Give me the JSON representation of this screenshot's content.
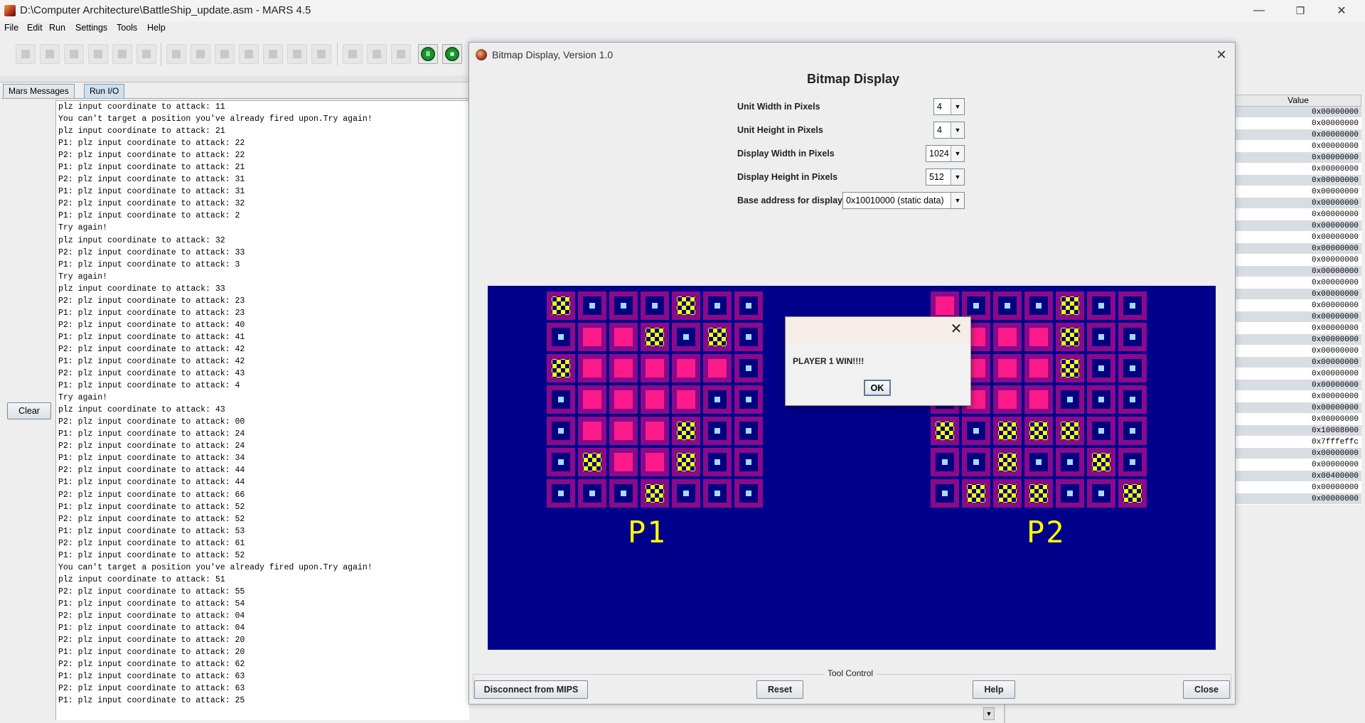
{
  "window": {
    "title": "D:\\Computer Architecture\\BattleShip_update.asm  - MARS 4.5",
    "minimize": "—",
    "maximize": "❐",
    "close": "✕"
  },
  "menu": [
    "File",
    "Edit",
    "Run",
    "Settings",
    "Tools",
    "Help"
  ],
  "tabs": [
    "Mars Messages",
    "Run I/O"
  ],
  "clear_label": "Clear",
  "console_lines": [
    "plz input coordinate to attack: 11",
    "You can't target a position you've already fired upon.Try again!",
    "plz input coordinate to attack: 21",
    "P1: plz input coordinate to attack: 22",
    "P2: plz input coordinate to attack: 22",
    "P1: plz input coordinate to attack: 21",
    "P2: plz input coordinate to attack: 31",
    "P1: plz input coordinate to attack: 31",
    "P2: plz input coordinate to attack: 32",
    "P1: plz input coordinate to attack: 2",
    "Try again!",
    "plz input coordinate to attack: 32",
    "P2: plz input coordinate to attack: 33",
    "P1: plz input coordinate to attack: 3",
    "Try again!",
    "plz input coordinate to attack: 33",
    "P2: plz input coordinate to attack: 23",
    "P1: plz input coordinate to attack: 23",
    "P2: plz input coordinate to attack: 40",
    "P1: plz input coordinate to attack: 41",
    "P2: plz input coordinate to attack: 42",
    "P1: plz input coordinate to attack: 42",
    "P2: plz input coordinate to attack: 43",
    "P1: plz input coordinate to attack: 4",
    "Try again!",
    "plz input coordinate to attack: 43",
    "P2: plz input coordinate to attack: 00",
    "P1: plz input coordinate to attack: 24",
    "P2: plz input coordinate to attack: 24",
    "P1: plz input coordinate to attack: 34",
    "P2: plz input coordinate to attack: 44",
    "P1: plz input coordinate to attack: 44",
    "P2: plz input coordinate to attack: 66",
    "P1: plz input coordinate to attack: 52",
    "P2: plz input coordinate to attack: 52",
    "P1: plz input coordinate to attack: 53",
    "P2: plz input coordinate to attack: 61",
    "P1: plz input coordinate to attack: 52",
    "You can't target a position you've already fired upon.Try again!",
    "plz input coordinate to attack: 51",
    "P2: plz input coordinate to attack: 55",
    "P1: plz input coordinate to attack: 54",
    "P2: plz input coordinate to attack: 04",
    "P1: plz input coordinate to attack: 04",
    "P2: plz input coordinate to attack: 20",
    "P1: plz input coordinate to attack: 20",
    "P2: plz input coordinate to attack: 62",
    "P1: plz input coordinate to attack: 63",
    "P2: plz input coordinate to attack: 63",
    "P1: plz input coordinate to attack: 25"
  ],
  "registers": {
    "header": "Value",
    "values": [
      "0x00000000",
      "0x00000000",
      "0x00000000",
      "0x00000000",
      "0x00000000",
      "0x00000000",
      "0x00000000",
      "0x00000000",
      "0x00000000",
      "0x00000000",
      "0x00000000",
      "0x00000000",
      "0x00000000",
      "0x00000000",
      "0x00000000",
      "0x00000000",
      "0x00000000",
      "0x00000000",
      "0x00000000",
      "0x00000000",
      "0x00000000",
      "0x00000000",
      "0x00000000",
      "0x00000000",
      "0x00000000",
      "0x00000000",
      "0x00000000",
      "0x00000000",
      "0x10008000",
      "0x7fffeffc",
      "0x00000000",
      "0x00000000",
      "0x00400000",
      "0x00000000",
      "0x00000000"
    ]
  },
  "bitmap_dialog": {
    "title": "Bitmap Display, Version 1.0",
    "heading": "Bitmap Display",
    "settings": [
      {
        "label": "Unit Width in Pixels",
        "value": "4"
      },
      {
        "label": "Unit Height in Pixels",
        "value": "4"
      },
      {
        "label": "Display Width in Pixels",
        "value": "1024"
      },
      {
        "label": "Display Height in Pixels",
        "value": "512"
      },
      {
        "label": "Base address for display",
        "value": "0x10010000 (static data)"
      }
    ],
    "tool_control": "Tool Control",
    "buttons": {
      "disconnect": "Disconnect from MIPS",
      "reset": "Reset",
      "help": "Help",
      "close": "Close"
    },
    "close_icon": "✕"
  },
  "boards": {
    "legend": {
      "W": "water",
      "S": "ship",
      "H": "hit"
    },
    "p1_label": "P1",
    "p2_label": "P2",
    "p1": [
      "HWWWHWW",
      "WSSHWHW",
      "HSSSSSW",
      "WSSSSWW",
      "WSSSHWW",
      "WHSSHWW",
      "WWWHWWW"
    ],
    "p2": [
      "SWWWHWW",
      "WSSSHWW",
      "WSSSHWW",
      "WSSSWWW",
      "HWHHHWW",
      "WWHWWHW",
      "WHHHWWH"
    ]
  },
  "popup": {
    "message": "PLAYER 1 WIN!!!!",
    "ok": "OK",
    "close_icon": "✕"
  },
  "colors": {
    "display_bg": "#00008a",
    "cell_border": "#8a0a8a",
    "ship": "#ff1a8c",
    "hit": "#ffff00",
    "label": "#ffff00"
  }
}
